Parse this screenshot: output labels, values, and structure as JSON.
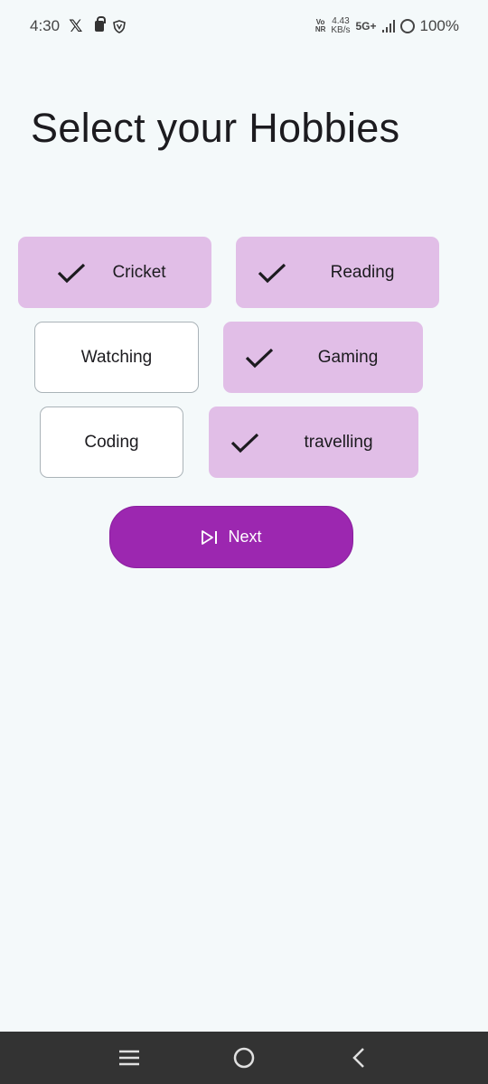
{
  "status_bar": {
    "time": "4:30",
    "x_logo": "𝕏",
    "volte_top": "Vo",
    "volte_bottom": "NR",
    "speed_value": "4.43",
    "speed_unit": "KB/s",
    "network": "5G+",
    "battery": "100%"
  },
  "title": "Select your Hobbies",
  "hobbies": [
    {
      "label": "Cricket",
      "selected": true
    },
    {
      "label": "Reading",
      "selected": true
    },
    {
      "label": "Watching",
      "selected": false
    },
    {
      "label": "Gaming",
      "selected": true
    },
    {
      "label": "Coding",
      "selected": false
    },
    {
      "label": "travelling",
      "selected": true
    }
  ],
  "next_button": {
    "label": "Next"
  },
  "colors": {
    "background": "#f4f9fa",
    "chip_selected": "#e1bee7",
    "chip_unselected": "#ffffff",
    "primary": "#9c27b0",
    "nav_bar": "#333333"
  },
  "nav": {
    "recents_icon": "recents-icon",
    "home_icon": "home-icon",
    "back_icon": "back-icon"
  }
}
